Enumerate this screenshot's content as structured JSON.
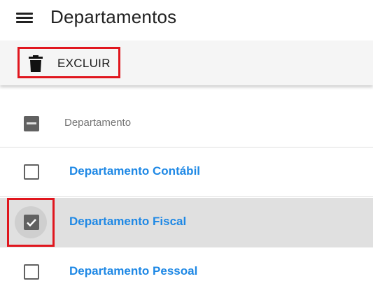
{
  "header": {
    "title": "Departamentos"
  },
  "toolbar": {
    "delete_label": "EXCLUIR"
  },
  "table": {
    "column_header": "Departamento",
    "rows": [
      {
        "label": "Departamento Contábil",
        "checked": false
      },
      {
        "label": "Departamento Fiscal",
        "checked": true
      },
      {
        "label": "Departamento Pessoal",
        "checked": false
      }
    ]
  },
  "colors": {
    "link": "#1e88e5",
    "selected_row": "#e0e0e0",
    "highlight": "#e0161e",
    "checkbox": "#616161"
  }
}
